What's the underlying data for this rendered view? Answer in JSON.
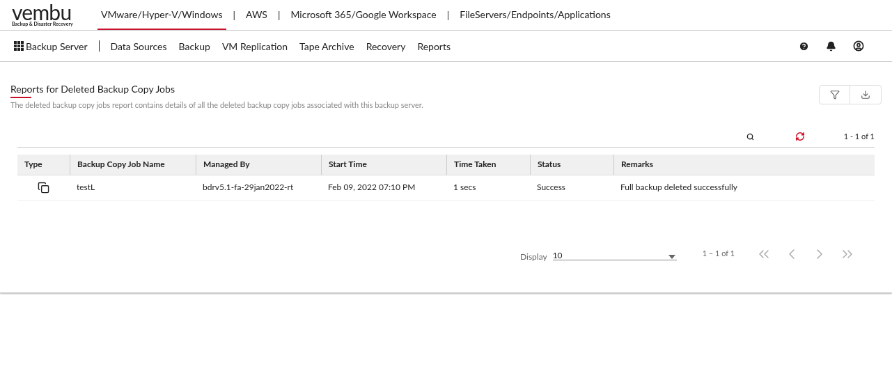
{
  "logo": {
    "name": "vembu",
    "tagline": "Backup & Disaster Recovery"
  },
  "product_tabs": [
    {
      "label": "VMware/Hyper-V/Windows",
      "selected": true
    },
    {
      "label": "AWS",
      "selected": false
    },
    {
      "label": "Microsoft 365/Google Workspace",
      "selected": false
    },
    {
      "label": "FileServers/Endpoints/Applications",
      "selected": false
    }
  ],
  "separator": "|",
  "server_menu": "Backup Server",
  "nav": [
    "Data Sources",
    "Backup",
    "VM Replication",
    "Tape Archive",
    "Recovery",
    "Reports"
  ],
  "page": {
    "title": "Reports for Deleted Backup Copy Jobs",
    "description": "The deleted backup copy jobs report contains details of all the deleted backup copy jobs associated with this backup server."
  },
  "range_top": "1 - 1 of 1",
  "table": {
    "columns": [
      "Type",
      "Backup Copy Job Name",
      "Managed By",
      "Start Time",
      "Time Taken",
      "Status",
      "Remarks"
    ],
    "rows": [
      {
        "name": "testL",
        "managed_by": "bdrv5.1-fa-29jan2022-rt",
        "start_time": "Feb 09, 2022 07:10 PM",
        "time_taken": "1 secs",
        "status": "Success",
        "remarks": "Full backup deleted successfully"
      }
    ]
  },
  "paginator": {
    "label": "Display",
    "page_size": "10",
    "range": "1 – 1 of 1"
  }
}
